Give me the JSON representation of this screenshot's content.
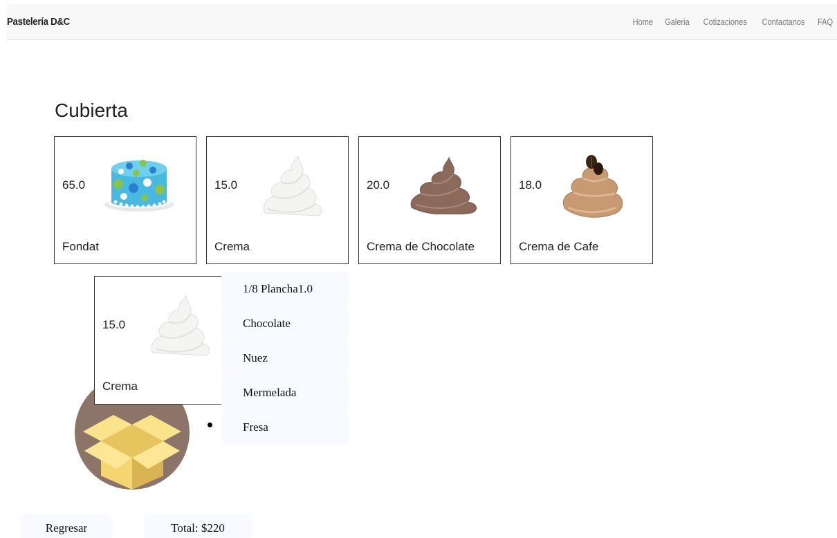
{
  "navbar": {
    "brand": "Pastelería D&C",
    "links": [
      "Home",
      "Galeria",
      "Cotizaciones",
      "Contactanos",
      "FAQ"
    ]
  },
  "section": {
    "title": "Cubierta"
  },
  "cards": [
    {
      "price": "65.0",
      "name": "Fondat",
      "icon": "fondant-cake-icon"
    },
    {
      "price": "15.0",
      "name": "Crema",
      "icon": "whipped-cream-icon"
    },
    {
      "price": "20.0",
      "name": "Crema de Chocolate",
      "icon": "chocolate-cream-icon"
    },
    {
      "price": "18.0",
      "name": "Crema de Cafe",
      "icon": "coffee-cream-icon"
    }
  ],
  "selected": {
    "price": "15.0",
    "name": "Crema",
    "icon": "whipped-cream-icon"
  },
  "summary_items": [
    "1/8 Plancha1.0",
    "Chocolate",
    "Nuez",
    "Mermelada",
    "Fresa"
  ],
  "buttons": {
    "back": "Regresar",
    "total": "Total: $220"
  },
  "colors": {
    "fondant": "#48b9e0",
    "chocolate": "#8b6a5c",
    "coffee": "#c89a72",
    "box_circle": "#8d7469",
    "box": "#f5d56f"
  }
}
